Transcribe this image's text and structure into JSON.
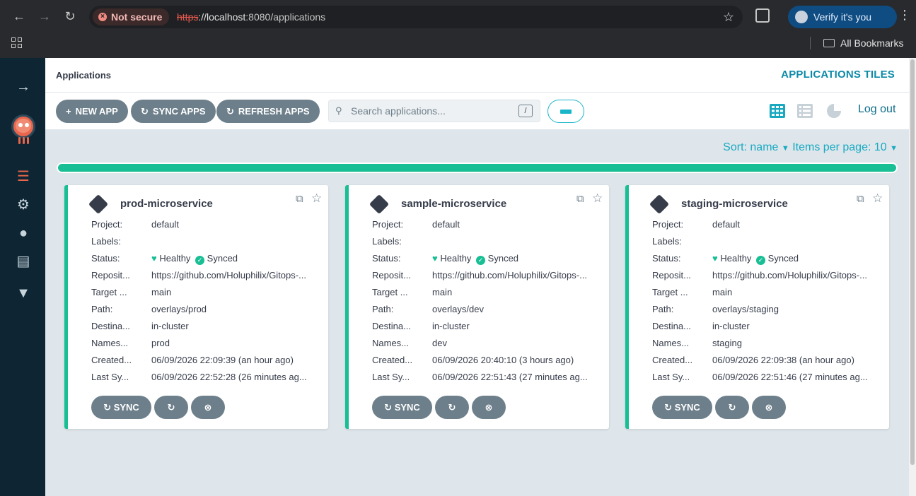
{
  "browser": {
    "security_label": "Not secure",
    "url_scheme": "https",
    "url_host": "://localhost",
    "url_rest": ":8080/applications",
    "verify_label": "Verify it's you",
    "bookmarks_label": "All Bookmarks"
  },
  "header": {
    "breadcrumb": "Applications",
    "title": "APPLICATIONS TILES"
  },
  "toolbar": {
    "new_app": "NEW APP",
    "sync_apps": "SYNC APPS",
    "refresh_apps": "REFRESH APPS",
    "search_placeholder": "Search applications...",
    "search_shortcut": "/",
    "logout": "Log out"
  },
  "sort": {
    "label": "Sort: name",
    "items_label": "Items per page: 10"
  },
  "colors": {
    "accent": "#18be94",
    "brand": "#0d8aa8",
    "button": "#6d7f8b"
  },
  "apps": [
    {
      "name": "prod-microservice",
      "project": "default",
      "labels": "",
      "health": "Healthy",
      "sync": "Synced",
      "repo": "https://github.com/Holuphilix/Gitops-...",
      "target": "main",
      "path": "overlays/prod",
      "destination": "in-cluster",
      "namespace": "prod",
      "created": "06/09/2026 22:09:39  (an hour ago)",
      "last_sync": "06/09/2026 22:52:28  (26 minutes ag..."
    },
    {
      "name": "sample-microservice",
      "project": "default",
      "labels": "",
      "health": "Healthy",
      "sync": "Synced",
      "repo": "https://github.com/Holuphilix/Gitops-...",
      "target": "main",
      "path": "overlays/dev",
      "destination": "in-cluster",
      "namespace": "dev",
      "created": "06/09/2026 20:40:10  (3 hours ago)",
      "last_sync": "06/09/2026 22:51:43  (27 minutes ag..."
    },
    {
      "name": "staging-microservice",
      "project": "default",
      "labels": "",
      "health": "Healthy",
      "sync": "Synced",
      "repo": "https://github.com/Holuphilix/Gitops-...",
      "target": "main",
      "path": "overlays/staging",
      "destination": "in-cluster",
      "namespace": "staging",
      "created": "06/09/2026 22:09:38  (an hour ago)",
      "last_sync": "06/09/2026 22:51:46  (27 minutes ag..."
    }
  ],
  "card_labels": {
    "project": "Project:",
    "labels": "Labels:",
    "status": "Status:",
    "repo": "Reposit...",
    "target": "Target ...",
    "path": "Path:",
    "destination": "Destina...",
    "namespace": "Names...",
    "created": "Created...",
    "last_sync": "Last Sy...",
    "sync_button": "SYNC"
  }
}
